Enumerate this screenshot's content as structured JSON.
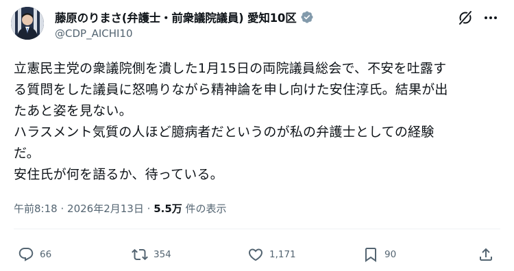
{
  "author": {
    "display_name": "藤原のりまさ(弁護士・前衆議院議員) 愛知10区",
    "handle": "@CDP_AICHI10",
    "verified": true
  },
  "header_icons": [
    "grok-icon",
    "more-icon"
  ],
  "tweet": {
    "lines": [
      "立憲民主党の衆議院側を潰した1月15日の両院議員総会で、不安を吐露す",
      "る質問をした議員に怒鳴りながら精神論を申し向けた安住淳氏。結果が出",
      "たあと姿を見ない。",
      "ハラスメント気質の人ほど臆病者だというのが私の弁護士としての経験",
      "だ。",
      "安住氏が何を語るか、待っている。"
    ]
  },
  "meta": {
    "time": "午前8:18",
    "separator": "·",
    "date": "2026年2月13日",
    "views": "5.5万",
    "views_label": "件の表示"
  },
  "actions": {
    "replies": "66",
    "reposts": "354",
    "likes": "1,171",
    "bookmarks": "90"
  },
  "colors": {
    "text": "#0f1419",
    "secondary": "#536471",
    "verified": "#829aab",
    "divider": "#eff3f4"
  }
}
